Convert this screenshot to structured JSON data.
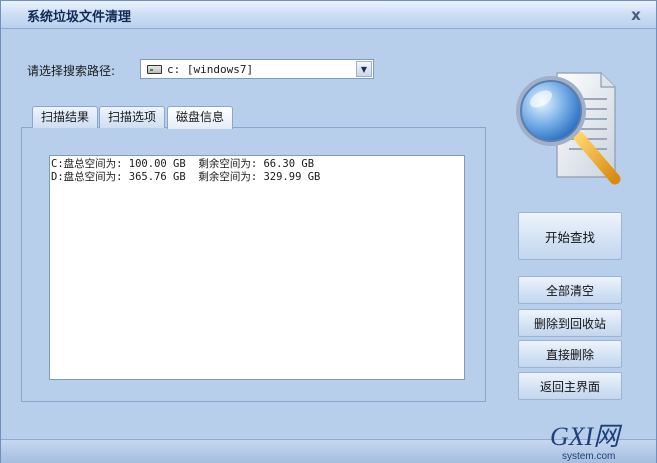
{
  "window": {
    "title": "系统垃圾文件清理",
    "close_glyph": "x"
  },
  "search": {
    "label": "请选择搜索路径:",
    "path_value": "c: [windows7]",
    "arrow_glyph": "▼"
  },
  "tabs": [
    {
      "label": "扫描结果",
      "active": false
    },
    {
      "label": "扫描选项",
      "active": false
    },
    {
      "label": "磁盘信息",
      "active": true
    }
  ],
  "disk_info": {
    "lines": [
      "C:盘总空间为: 100.00 GB  剩余空间为: 66.30 GB",
      "D:盘总空间为: 365.76 GB  剩余空间为: 329.99 GB"
    ]
  },
  "buttons": {
    "start": "开始查找",
    "clear_all": "全部清空",
    "delete_to_recycle": "删除到回收站",
    "delete_direct": "直接删除",
    "return_home": "返回主界面"
  },
  "watermark": {
    "brand": "GXI网",
    "domain": "system.com"
  },
  "colors": {
    "window_bg": "#b8cfec",
    "accent": "#0f2a55"
  },
  "icons": {
    "search_logo": "magnifier-document-icon",
    "drive": "drive-icon"
  }
}
